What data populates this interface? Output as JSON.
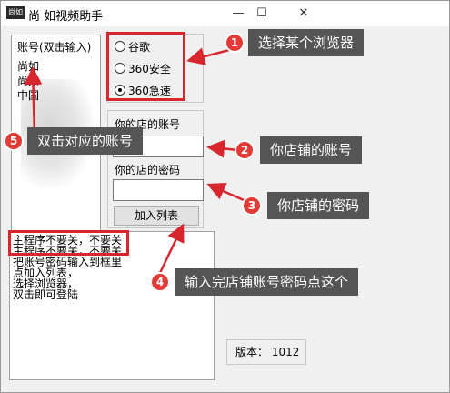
{
  "window": {
    "title": "尚 如视频助手",
    "icon_text": "尚如",
    "min": "—",
    "max": "☐",
    "close": "✕"
  },
  "list": {
    "header": "账号(双击输入)",
    "items": [
      "尚如",
      "尚如",
      "中国"
    ]
  },
  "browser": {
    "options": [
      "谷歌",
      "360安全",
      "360急速"
    ],
    "selected": "360急速"
  },
  "account": {
    "account_label": "你的店的账号",
    "account_value": "",
    "password_label": "你的店的密码",
    "password_value": "",
    "add_button": "加入列表"
  },
  "notes": {
    "lines": [
      "主程序不要关，不要关",
      "主程序不要关，不要关",
      "把账号密码输入到框里",
      "点加入列表，",
      "选择浏览器，",
      "双击即可登陆"
    ]
  },
  "version": {
    "label": "版本：",
    "value": "1012"
  },
  "annotations": [
    {
      "number": "1",
      "text": "选择某个浏览器"
    },
    {
      "number": "2",
      "text": "你店铺的账号"
    },
    {
      "number": "3",
      "text": "你店铺的密码"
    },
    {
      "number": "4",
      "text": "输入完店铺账号密码点这个"
    },
    {
      "number": "5",
      "text": "双击对应的账号"
    }
  ],
  "colors": {
    "annotation_red": "#d8262f",
    "callout_bg": "#555555",
    "badge_red": "#e53935"
  }
}
